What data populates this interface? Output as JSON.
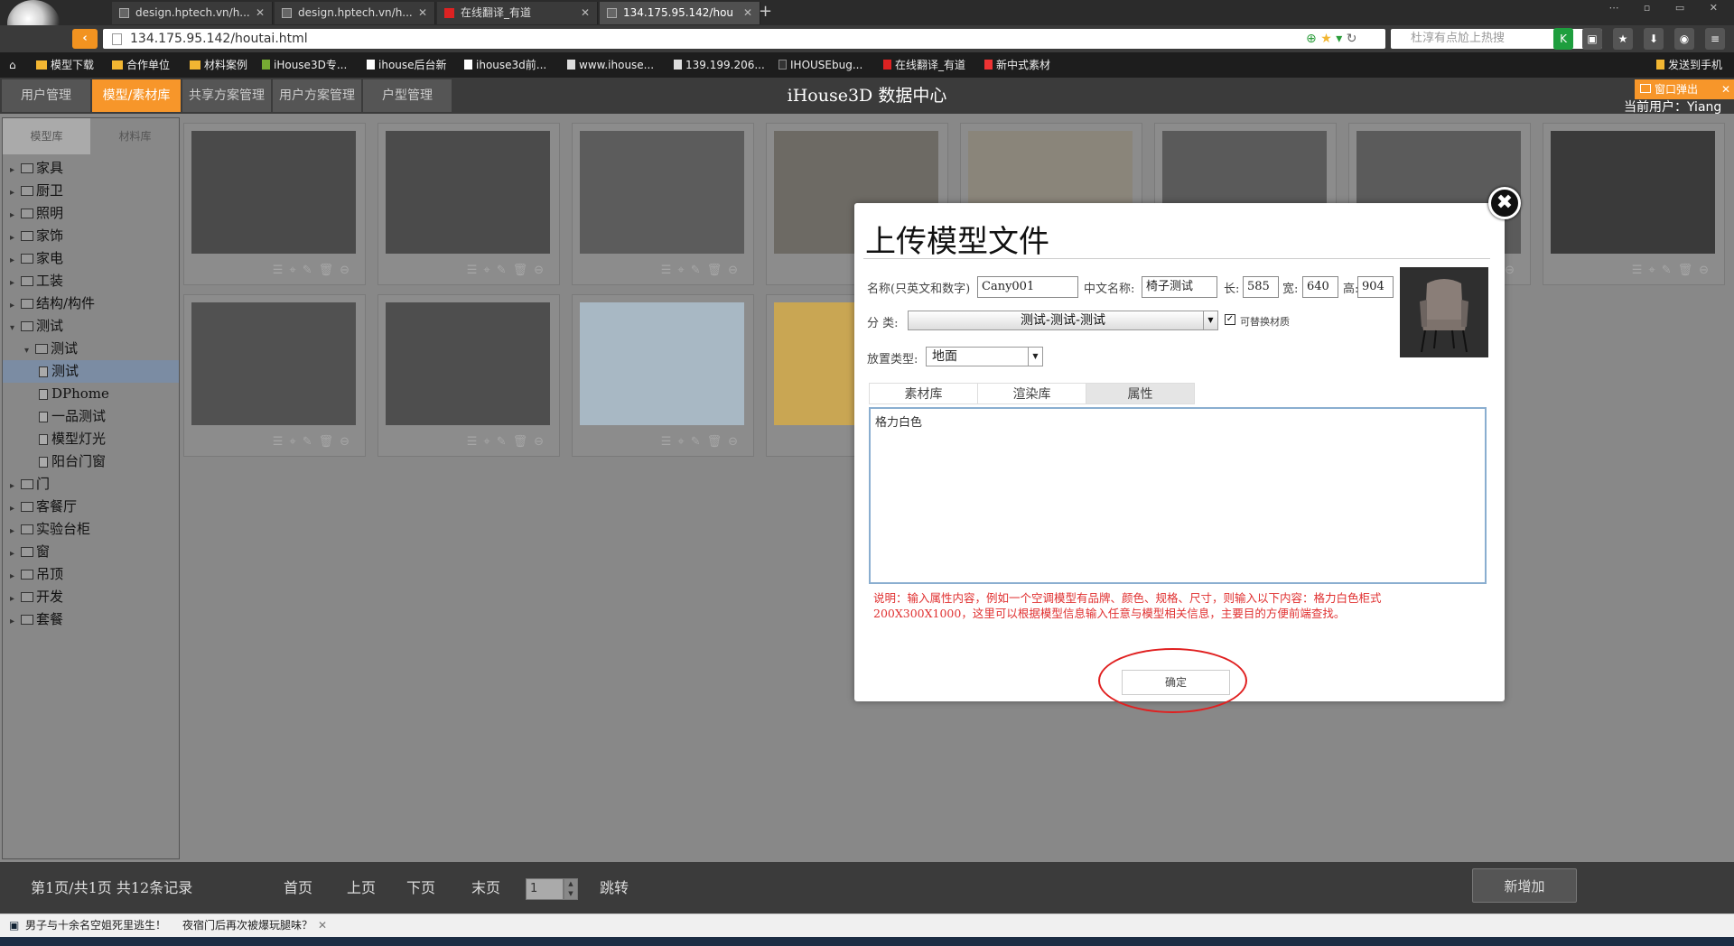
{
  "browser": {
    "tabs": [
      {
        "label": "design.hptech.vn/h..."
      },
      {
        "label": "design.hptech.vn/h..."
      },
      {
        "label": "在线翻译_有道"
      },
      {
        "label": "134.175.95.142/hou"
      }
    ],
    "url": "134.175.95.142/houtai.html",
    "search_placeholder": "杜淳有点尬上热搜",
    "bookmarks": [
      "模型下载",
      "合作单位",
      "材料案例",
      "iHouse3D专...",
      "ihouse后台新",
      "ihouse3d前...",
      "www.ihouse...",
      "139.199.206...",
      "IHOUSEbug...",
      "在线翻译_有道",
      "新中式素材"
    ],
    "send_to_phone": "发送到手机"
  },
  "app": {
    "title": "iHouse3D 数据中心",
    "nav": [
      "用户管理",
      "模型/素材库",
      "共享方案管理",
      "用户方案管理",
      "户型管理"
    ],
    "active_nav": "模型/素材库",
    "popup_tag": "窗口弹出",
    "user_text": "当前用户：Yiang"
  },
  "sidebar": {
    "tabs": [
      "模型库",
      "材料库"
    ],
    "tree": [
      {
        "label": "家具",
        "level": 0,
        "type": "folder",
        "open": false
      },
      {
        "label": "厨卫",
        "level": 0,
        "type": "folder",
        "open": false
      },
      {
        "label": "照明",
        "level": 0,
        "type": "folder",
        "open": false
      },
      {
        "label": "家饰",
        "level": 0,
        "type": "folder",
        "open": false
      },
      {
        "label": "家电",
        "level": 0,
        "type": "folder",
        "open": false
      },
      {
        "label": "工装",
        "level": 0,
        "type": "folder",
        "open": false
      },
      {
        "label": "结构/构件",
        "level": 0,
        "type": "folder",
        "open": false
      },
      {
        "label": "测试",
        "level": 0,
        "type": "folder",
        "open": true
      },
      {
        "label": "测试",
        "level": 1,
        "type": "folder",
        "open": true
      },
      {
        "label": "测试",
        "level": 2,
        "type": "doc",
        "selected": true
      },
      {
        "label": "DPhome",
        "level": 2,
        "type": "doc"
      },
      {
        "label": "一品测试",
        "level": 2,
        "type": "doc"
      },
      {
        "label": "模型灯光",
        "level": 2,
        "type": "doc"
      },
      {
        "label": "阳台门窗",
        "level": 2,
        "type": "doc"
      },
      {
        "label": "门",
        "level": 0,
        "type": "folder",
        "open": false
      },
      {
        "label": "客餐厅",
        "level": 0,
        "type": "folder",
        "open": false
      },
      {
        "label": "实验台柜",
        "level": 0,
        "type": "folder",
        "open": false
      },
      {
        "label": "窗",
        "level": 0,
        "type": "folder",
        "open": false
      },
      {
        "label": "吊顶",
        "level": 0,
        "type": "folder",
        "open": false
      },
      {
        "label": "开发",
        "level": 0,
        "type": "folder",
        "open": false
      },
      {
        "label": "套餐",
        "level": 0,
        "type": "folder",
        "open": false
      }
    ]
  },
  "grid": {
    "cards": [
      {
        "name": "empty-scene",
        "color": "#4a4a4a"
      },
      {
        "name": "teapot-wireframe",
        "color": "#4b4b4b"
      },
      {
        "name": "floor-tile",
        "color": "#5c5c5c"
      },
      {
        "name": "floor-tile-2",
        "color": "#6d6a64"
      },
      {
        "name": "wood-texture",
        "color": "#8a857a"
      },
      {
        "name": "lamp",
        "color": "#5a5a5a"
      },
      {
        "name": "pendant-light",
        "color": "#5b5b5b"
      },
      {
        "name": "window-frame",
        "color": "#3a3a3a"
      },
      {
        "name": "corner-sofa",
        "color": "#515151"
      },
      {
        "name": "chandelier",
        "color": "#4e4e4e"
      },
      {
        "name": "leather-sofa",
        "color": "#a8b8c4"
      },
      {
        "name": "armchair",
        "color": "#c9a653"
      }
    ]
  },
  "footer": {
    "page_info": "第1页/共1页 共12条记录",
    "first": "首页",
    "prev": "上页",
    "next": "下页",
    "last": "末页",
    "page_value": "1",
    "jump": "跳转",
    "add": "新增加"
  },
  "status": {
    "news1": "男子与十余名空姐死里逃生！",
    "news2": "夜宿门后再次被爆玩腿味？"
  },
  "modal": {
    "title": "上传模型文件",
    "name_label": "名称(只英文和数字)",
    "name_value": "Cany001",
    "cn_label": "中文名称:",
    "cn_value": "椅子测试",
    "len_label": "长:",
    "len_value": "585",
    "width_label": "宽:",
    "width_value": "640",
    "height_label": "高:",
    "height_value": "904",
    "category_label": "分 类:",
    "category_value": "测试-测试-测试",
    "replace_material_label": "可替换材质",
    "replace_material_checked": true,
    "place_label": "放置类型:",
    "place_value": "地面",
    "tabs": [
      "素材库",
      "渲染库",
      "属性"
    ],
    "active_tab": "属性",
    "attr_value": "格力白色",
    "note": "说明：输入属性内容，例如一个空调模型有品牌、颜色、规格、尺寸，则输入以下内容：格力白色柜式200X300X1000，这里可以根据模型信息输入任意与模型相关信息，主要目的方便前端查找。",
    "ok_label": "确定"
  }
}
